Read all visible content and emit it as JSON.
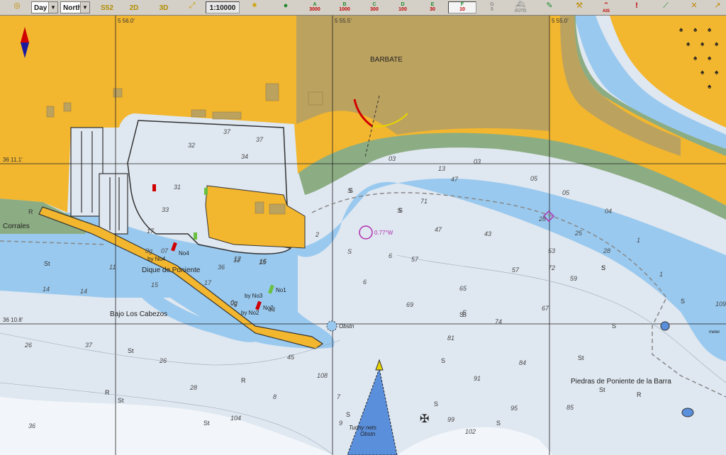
{
  "toolbar": {
    "mode_select": "Day",
    "orientation_select": "North",
    "scale": "1:10000",
    "view_buttons": [
      "S52",
      "2D",
      "3D"
    ],
    "depth_filters": [
      {
        "letter": "A",
        "value": "3000"
      },
      {
        "letter": "B",
        "value": "1000"
      },
      {
        "letter": "C",
        "value": "300"
      },
      {
        "letter": "D",
        "value": "100"
      },
      {
        "letter": "E",
        "value": "30"
      },
      {
        "letter": "F",
        "value": "10"
      },
      {
        "letter": "G",
        "value": "5"
      }
    ],
    "tools": [
      "AUTO",
      "AIS"
    ],
    "colors": {
      "land": "#f2b62f",
      "builtup": "#bca25f",
      "shallow": "#99c9ef",
      "deep": "#dfe7f0",
      "intertidal": "#8cad83"
    }
  },
  "chart": {
    "place_names": [
      "BARBATE",
      "Corrales",
      "Dique de Poniente",
      "Bajo Los Cabezos",
      "Piedras de Poniente de la Barra"
    ],
    "latitudes": [
      "36 11.1'",
      "36 10.8'"
    ],
    "longitudes": [
      "5 56.0'",
      "5 55.5'",
      "5 55.0'"
    ],
    "buoys": [
      {
        "by": "by No4",
        "tag": "No4"
      },
      {
        "by": "by No3",
        "tag": ""
      },
      {
        "by": "by No1",
        "tag": "No1"
      },
      {
        "by": "by No2",
        "tag": "No2"
      }
    ],
    "obstruction_1": "Obstn",
    "obstruction_2_line1": "Tunny nets",
    "obstruction_2_line2": "Obstn",
    "variation": "0.77°W",
    "corner_tag": "meter",
    "seabed_labels": [
      "St",
      "S",
      "R"
    ],
    "soundings": [
      "03",
      "03",
      "13",
      "05",
      "05",
      "04",
      "28",
      "25",
      "28",
      "S",
      "S",
      "S",
      "S",
      "S",
      "47",
      "43",
      "57",
      "57",
      "65",
      "69",
      "74",
      "81",
      "84",
      "91",
      "95",
      "99",
      "85",
      "67",
      "72",
      "59",
      "53",
      "47",
      "2",
      "1",
      "0g",
      "1",
      "12",
      "15",
      "17",
      "14",
      "11",
      "14",
      "0g",
      "17",
      "15",
      "0g",
      "36",
      "31",
      "33",
      "34",
      "32",
      "37",
      "37",
      "26",
      "28",
      "45",
      "44",
      "36",
      "37",
      "26",
      "12",
      "15",
      "07",
      "6",
      "6",
      "7",
      "8",
      "9",
      "102",
      "104",
      "108",
      "109",
      "71",
      "2",
      "32"
    ]
  }
}
